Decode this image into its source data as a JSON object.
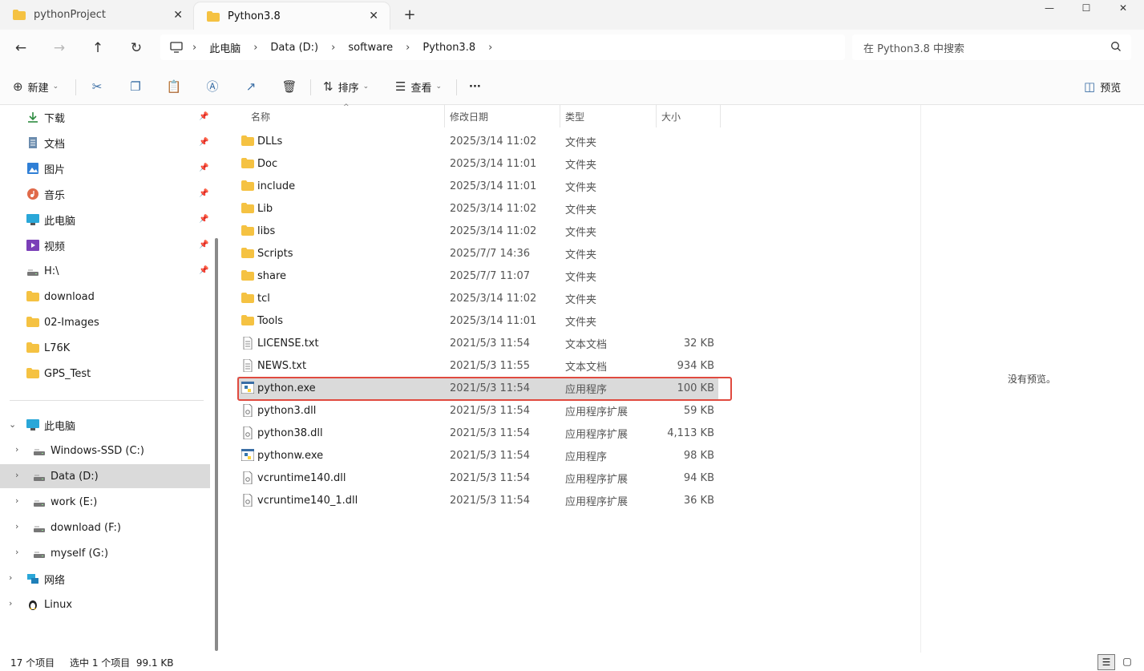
{
  "tabs": [
    {
      "label": "pythonProject",
      "active": false
    },
    {
      "label": "Python3.8",
      "active": true
    }
  ],
  "address": {
    "crumbs": [
      "此电脑",
      "Data (D:)",
      "software",
      "Python3.8"
    ],
    "search_placeholder": "在 Python3.8 中搜索"
  },
  "commands": {
    "new_label": "新建",
    "sort_label": "排序",
    "view_label": "查看",
    "more_label": "···",
    "preview_label": "预览"
  },
  "sidebar": {
    "quick_access": [
      {
        "label": "下载",
        "icon": "download-icon",
        "pinned": true
      },
      {
        "label": "文档",
        "icon": "document-icon",
        "pinned": true
      },
      {
        "label": "图片",
        "icon": "picture-icon",
        "pinned": true
      },
      {
        "label": "音乐",
        "icon": "music-icon",
        "pinned": true
      },
      {
        "label": "此电脑",
        "icon": "computer-icon",
        "pinned": true
      },
      {
        "label": "视频",
        "icon": "video-icon",
        "pinned": true
      },
      {
        "label": "H:\\",
        "icon": "drive-icon",
        "pinned": true
      },
      {
        "label": "download",
        "icon": "folder-icon",
        "pinned": false
      },
      {
        "label": "02-Images",
        "icon": "folder-icon",
        "pinned": false
      },
      {
        "label": "L76K",
        "icon": "folder-icon",
        "pinned": false
      },
      {
        "label": "GPS_Test",
        "icon": "folder-icon",
        "pinned": false
      }
    ],
    "this_pc": "此电脑",
    "drives": [
      {
        "label": "Windows-SSD (C:)",
        "selected": false
      },
      {
        "label": "Data (D:)",
        "selected": true
      },
      {
        "label": "work (E:)",
        "selected": false
      },
      {
        "label": "download (F:)",
        "selected": false
      },
      {
        "label": "myself (G:)",
        "selected": false
      }
    ],
    "network": "网络",
    "linux": "Linux"
  },
  "columns": {
    "name": "名称",
    "date": "修改日期",
    "type": "类型",
    "size": "大小"
  },
  "files": [
    {
      "name": "DLLs",
      "date": "2025/3/14 11:02",
      "type": "文件夹",
      "size": "",
      "kind": "folder"
    },
    {
      "name": "Doc",
      "date": "2025/3/14 11:01",
      "type": "文件夹",
      "size": "",
      "kind": "folder"
    },
    {
      "name": "include",
      "date": "2025/3/14 11:01",
      "type": "文件夹",
      "size": "",
      "kind": "folder"
    },
    {
      "name": "Lib",
      "date": "2025/3/14 11:02",
      "type": "文件夹",
      "size": "",
      "kind": "folder"
    },
    {
      "name": "libs",
      "date": "2025/3/14 11:02",
      "type": "文件夹",
      "size": "",
      "kind": "folder"
    },
    {
      "name": "Scripts",
      "date": "2025/7/7 14:36",
      "type": "文件夹",
      "size": "",
      "kind": "folder"
    },
    {
      "name": "share",
      "date": "2025/7/7 11:07",
      "type": "文件夹",
      "size": "",
      "kind": "folder"
    },
    {
      "name": "tcl",
      "date": "2025/3/14 11:02",
      "type": "文件夹",
      "size": "",
      "kind": "folder"
    },
    {
      "name": "Tools",
      "date": "2025/3/14 11:01",
      "type": "文件夹",
      "size": "",
      "kind": "folder"
    },
    {
      "name": "LICENSE.txt",
      "date": "2021/5/3 11:54",
      "type": "文本文档",
      "size": "32 KB",
      "kind": "text"
    },
    {
      "name": "NEWS.txt",
      "date": "2021/5/3 11:55",
      "type": "文本文档",
      "size": "934 KB",
      "kind": "text"
    },
    {
      "name": "python.exe",
      "date": "2021/5/3 11:54",
      "type": "应用程序",
      "size": "100 KB",
      "kind": "exe",
      "selected": true
    },
    {
      "name": "python3.dll",
      "date": "2021/5/3 11:54",
      "type": "应用程序扩展",
      "size": "59 KB",
      "kind": "dll"
    },
    {
      "name": "python38.dll",
      "date": "2021/5/3 11:54",
      "type": "应用程序扩展",
      "size": "4,113 KB",
      "kind": "dll"
    },
    {
      "name": "pythonw.exe",
      "date": "2021/5/3 11:54",
      "type": "应用程序",
      "size": "98 KB",
      "kind": "exe"
    },
    {
      "name": "vcruntime140.dll",
      "date": "2021/5/3 11:54",
      "type": "应用程序扩展",
      "size": "94 KB",
      "kind": "dll"
    },
    {
      "name": "vcruntime140_1.dll",
      "date": "2021/5/3 11:54",
      "type": "应用程序扩展",
      "size": "36 KB",
      "kind": "dll"
    }
  ],
  "preview": {
    "empty_text": "没有预览。"
  },
  "status": {
    "count": "17 个项目",
    "selection": "选中 1 个项目  99.1 KB"
  },
  "colors": {
    "folder": "#f5c242",
    "highlight_box": "#e04a3f",
    "selection": "#dadada"
  }
}
